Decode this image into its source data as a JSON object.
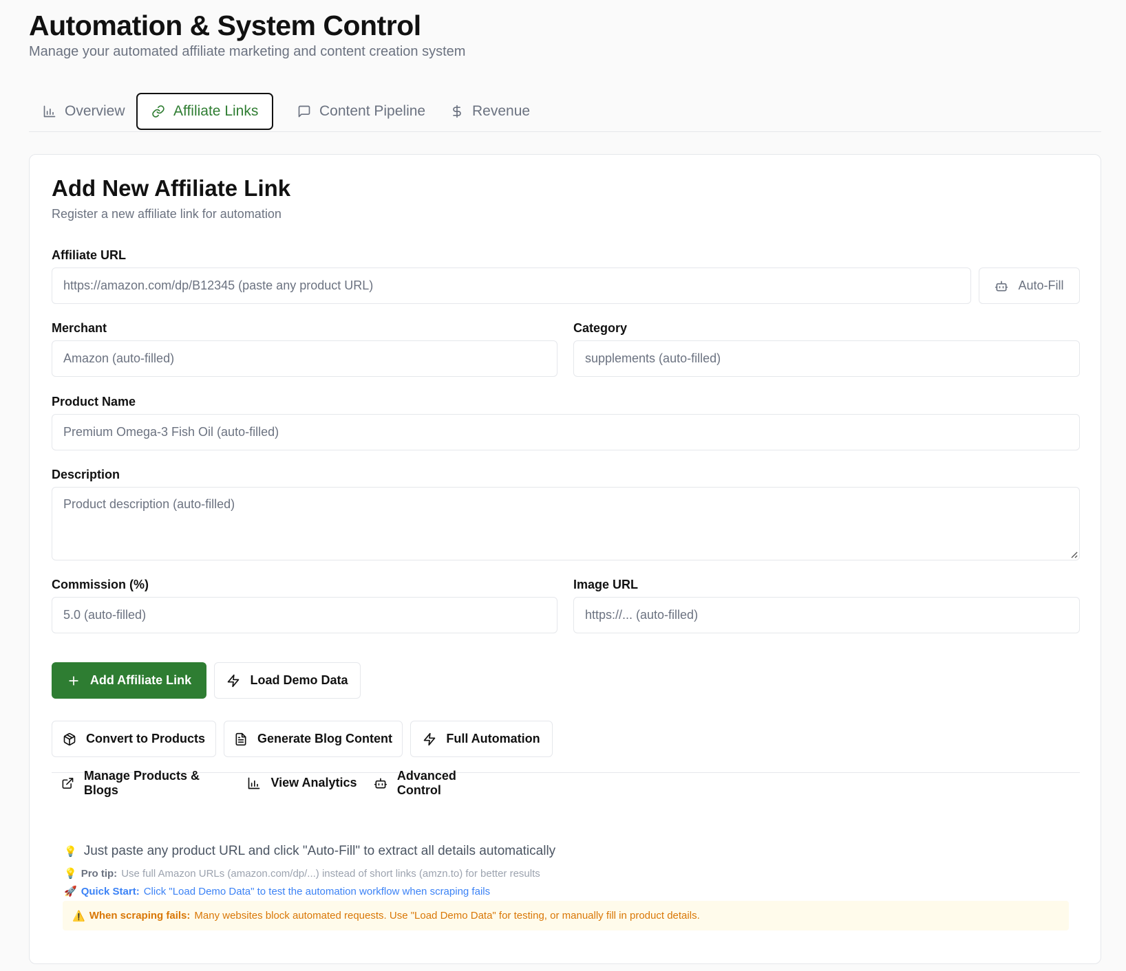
{
  "header": {
    "title": "Automation & System Control",
    "subtitle": "Manage your automated affiliate marketing and content creation system"
  },
  "tabs": [
    {
      "label": "Overview",
      "icon": "bar-chart-icon"
    },
    {
      "label": "Affiliate Links",
      "icon": "link-icon",
      "active": true
    },
    {
      "label": "Content Pipeline",
      "icon": "message-square-icon"
    },
    {
      "label": "Revenue",
      "icon": "dollar-icon"
    }
  ],
  "form": {
    "title": "Add New Affiliate Link",
    "subtitle": "Register a new affiliate link for automation",
    "affiliate_url": {
      "label": "Affiliate URL",
      "placeholder": "https://amazon.com/dp/B12345 (paste any product URL)"
    },
    "auto_fill_label": "Auto-Fill",
    "merchant": {
      "label": "Merchant",
      "placeholder": "Amazon (auto-filled)"
    },
    "category": {
      "label": "Category",
      "placeholder": "supplements (auto-filled)"
    },
    "product_name": {
      "label": "Product Name",
      "placeholder": "Premium Omega-3 Fish Oil (auto-filled)"
    },
    "description": {
      "label": "Description",
      "placeholder": "Product description (auto-filled)"
    },
    "commission": {
      "label": "Commission (%)",
      "placeholder": "5.0 (auto-filled)"
    },
    "image_url": {
      "label": "Image URL",
      "placeholder": "https://... (auto-filled)"
    }
  },
  "actions": {
    "add_link": "Add Affiliate Link",
    "load_demo": "Load Demo Data",
    "convert_products": "Convert to Products",
    "generate_blog": "Generate Blog Content",
    "full_automation": "Full Automation",
    "manage": "Manage Products & Blogs",
    "analytics": "View Analytics",
    "advanced": "Advanced Control"
  },
  "hints": {
    "main": "Just paste any product URL and click \"Auto-Fill\" to extract all details automatically",
    "tip_label": "Pro tip:",
    "tip_text": "Use full Amazon URLs (amazon.com/dp/...) instead of short links (amzn.to) for better results",
    "quick_label": "Quick Start:",
    "quick_text": "Click \"Load Demo Data\" to test the automation workflow when scraping fails",
    "warn_label": "When scraping fails:",
    "warn_text": "Many websites block automated requests. Use \"Load Demo Data\" for testing, or manually fill in product details."
  },
  "colors": {
    "accent": "#2e7d32",
    "quick_start": "#3b82f6",
    "warning": "#d97706"
  }
}
